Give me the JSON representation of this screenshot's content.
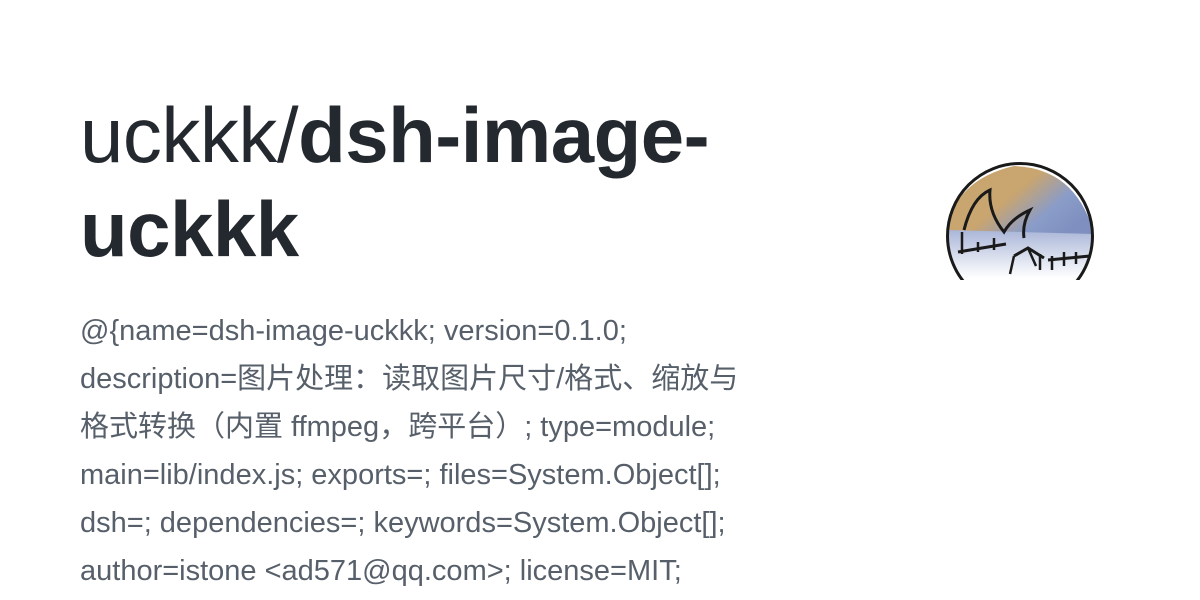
{
  "repo": {
    "owner": "uckkk/",
    "name": "dsh-image-uckkk",
    "description": "@{name=dsh-image-uckkk; version=0.1.0;\ndescription=图片处理：读取图片尺寸/格式、缩放与\n格式转换（内置 ffmpeg，跨平台）; type=module;\nmain=lib/index.js; exports=; files=System.Object[];\ndsh=; dependencies=; keywords=System.Object[];\nauthor=istone <ad571@qq.com>; license=MIT;"
  },
  "avatar": {
    "icon": "owner-avatar-icon",
    "colors": {
      "tan": "#c8a46e",
      "blue": "#8a9cc8",
      "outline": "#1a1a1a"
    }
  }
}
